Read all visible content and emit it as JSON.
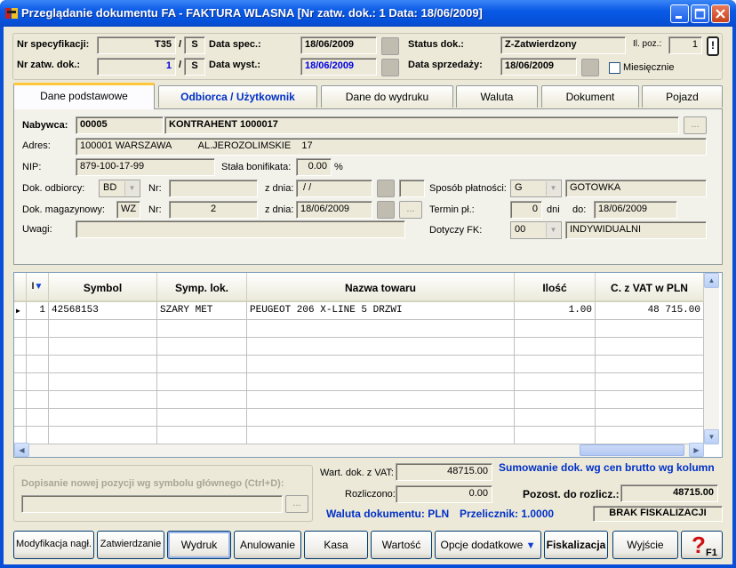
{
  "window": {
    "title": "Przeglądanie dokumentu FA - FAKTURA WLASNA   [Nr zatw. dok.:       1  Data: 18/06/2009]"
  },
  "header": {
    "nr_spec_label": "Nr specyfikacji:",
    "nr_spec_value": "T35",
    "nr_spec_suffix": "S",
    "nr_zatw_label": "Nr zatw. dok.:",
    "nr_zatw_value": "1",
    "nr_zatw_suffix": "S",
    "data_spec_label": "Data spec.:",
    "data_spec_value": "18/06/2009",
    "data_wyst_label": "Data wyst.:",
    "data_wyst_value": "18/06/2009",
    "status_label": "Status dok.:",
    "status_value": "Z-Zatwierdzony",
    "data_sprz_label": "Data sprzedaży:",
    "data_sprz_value": "18/06/2009",
    "il_poz_label": "Il. poz.:",
    "il_poz_value": "1",
    "info_btn": "!",
    "miesiecznie_label": "Miesięcznie"
  },
  "tabs": [
    "Dane podstawowe",
    "Odbiorca / Użytkownik",
    "Dane do wydruku",
    "Waluta",
    "Dokument",
    "Pojazd"
  ],
  "panel": {
    "nabywca_label": "Nabywca:",
    "nabywca_code": "00005",
    "nabywca_name": "KONTRAHENT 1000017",
    "adres_label": "Adres:",
    "adres_value": "100001 WARSZAWA          AL.JEROZOLIMSKIE    17",
    "nip_label": "NIP:",
    "nip_value": "879-100-17-99",
    "bonifikata_label": "Stała bonifikata:",
    "bonifikata_value": "0.00",
    "bonifikata_unit": "%",
    "dok_odb_label": "Dok. odbiorcy:",
    "dok_odb_value": "BD",
    "nr_label": "Nr:",
    "nr_odb_value": "",
    "zdnia_label": "z dnia:",
    "zdnia_odb_value": " / /",
    "dok_mag_label": "Dok. magazynowy:",
    "dok_mag_value": "WZ",
    "nr_mag_value": "2",
    "zdnia_mag_value": "18/06/2009",
    "uwagi_label": "Uwagi:",
    "uwagi_value": "",
    "sposob_label": "Sposób płatności:",
    "sposob_code": "G",
    "sposob_value": "GOTOWKA",
    "termin_label": "Termin pł.:",
    "termin_value": "0",
    "dni_label": "dni",
    "do_label": "do:",
    "do_value": "18/06/2009",
    "dotyczy_label": "Dotyczy FK:",
    "dotyczy_code": "00",
    "dotyczy_value": "INDYWIDUALNI",
    "dots": "..."
  },
  "grid": {
    "columns": [
      "l",
      "Symbol",
      "Symp. lok.",
      "Nazwa towaru",
      "Ilość",
      "C. z VAT w PLN"
    ],
    "rows": [
      {
        "lp": "1",
        "symbol": "42568153",
        "symp": "SZARY MET",
        "nazwa": "PEUGEOT 206 X-LINE 5 DRZWI",
        "ilosc": "1.00",
        "cena": "48 715.00"
      }
    ]
  },
  "bottom": {
    "dopisanie_label": "Dopisanie nowej pozycji wg symbolu głównego (Ctrl+D):",
    "wart_label": "Wart. dok. z VAT:",
    "wart_value": "48715.00",
    "sumowanie_label": "Sumowanie dok. wg cen brutto wg kolumn",
    "rozliczono_label": "Rozliczono:",
    "rozliczono_value": "0.00",
    "pozost_label": "Pozost. do rozlicz.:",
    "pozost_value": "48715.00",
    "waluta_label": "Waluta dokumentu: PLN",
    "przelicznik_label": "Przelicznik: 1.0000",
    "fiskal_status": "BRAK FISKALIZACJI"
  },
  "buttons": [
    "Modyfikacja nagł.",
    "Zatwierdzanie",
    "Wydruk",
    "Anulowanie",
    "Kasa",
    "Wartość",
    "Opcje dodatkowe",
    "Fiskalizacja",
    "Wyjście"
  ]
}
